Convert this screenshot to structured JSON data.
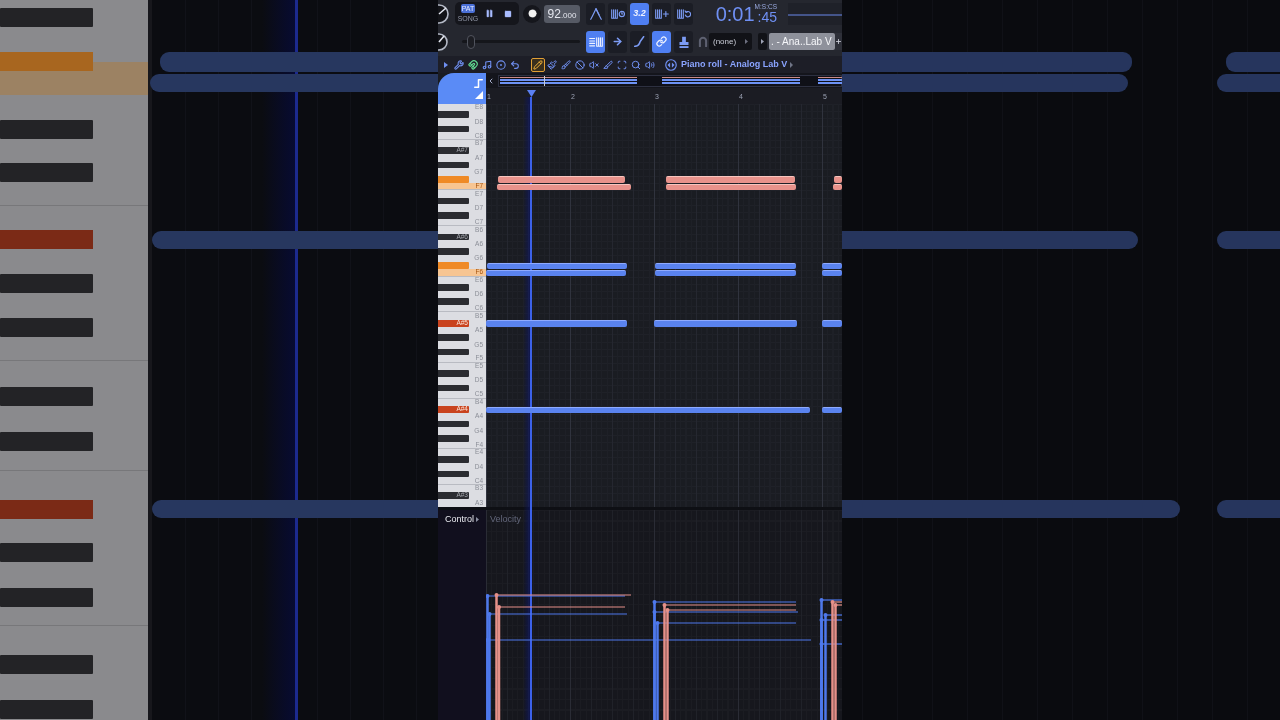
{
  "toolbar": {
    "mode_switch": [
      {
        "label": "PAT",
        "selected": true
      },
      {
        "label": "SONG",
        "selected": false
      }
    ],
    "playing": true,
    "tempo": {
      "whole": "92",
      "decimals": ".000"
    },
    "record_options": [
      {
        "selected": false
      },
      {
        "selected": false
      },
      {
        "label": "3.2",
        "selected": true
      },
      {
        "selected": false
      },
      {
        "selected": false
      }
    ],
    "time": {
      "main": "0:01",
      "centis": ":45",
      "format": "M:S:CS"
    }
  },
  "toolbar_row2": {
    "slider": {
      "level": 0.08
    },
    "buttons": [
      {
        "selected": true
      },
      {
        "selected": false
      },
      {
        "selected": false
      },
      {
        "selected": true
      },
      {
        "selected": false
      }
    ],
    "target": "(none)",
    "channel": ". - Ana..Lab V"
  },
  "tool_strip": {
    "snap": {
      "on": true
    },
    "tools": [
      {
        "selected": true
      },
      {
        "selected": false
      },
      {
        "selected": false
      },
      {
        "selected": false
      },
      {
        "selected": false
      },
      {
        "selected": false
      },
      {
        "selected": false
      },
      {
        "selected": false
      },
      {
        "selected": false
      }
    ],
    "title": "Piano roll - Analog Lab V"
  },
  "ruler": [
    "1",
    "2",
    "3",
    "4",
    "5"
  ],
  "keys": [
    {
      "label": "E8",
      "kind": "white",
      "pressed": false
    },
    {
      "kind": "black",
      "pressed": false
    },
    {
      "label": "D8",
      "kind": "white",
      "pressed": false
    },
    {
      "kind": "black",
      "pressed": false
    },
    {
      "label": "C8",
      "kind": "white",
      "pressed": false
    },
    {
      "label": "B7",
      "kind": "white",
      "pressed": false
    },
    {
      "label": "A#7",
      "kind": "black",
      "pressed": false
    },
    {
      "label": "A7",
      "kind": "white",
      "pressed": false
    },
    {
      "kind": "black",
      "pressed": false
    },
    {
      "label": "G7",
      "kind": "white",
      "pressed": false
    },
    {
      "kind": "black",
      "pressed": true,
      "color": "#ef8a26"
    },
    {
      "label": "F7",
      "kind": "white",
      "pressed": true,
      "color": "#f7c592"
    },
    {
      "label": "E7",
      "kind": "white",
      "pressed": false
    },
    {
      "kind": "black",
      "pressed": false
    },
    {
      "label": "D7",
      "kind": "white",
      "pressed": false
    },
    {
      "kind": "black",
      "pressed": false
    },
    {
      "label": "C7",
      "kind": "white",
      "pressed": false
    },
    {
      "label": "B6",
      "kind": "white",
      "pressed": false
    },
    {
      "label": "A#6",
      "kind": "black",
      "pressed": false
    },
    {
      "label": "A6",
      "kind": "white",
      "pressed": false
    },
    {
      "kind": "black",
      "pressed": false
    },
    {
      "label": "G6",
      "kind": "white",
      "pressed": false
    },
    {
      "kind": "black",
      "pressed": true,
      "color": "#ef8a26"
    },
    {
      "label": "F6",
      "kind": "white",
      "pressed": true,
      "color": "#f7c592"
    },
    {
      "label": "E6",
      "kind": "white",
      "pressed": false
    },
    {
      "kind": "black",
      "pressed": false
    },
    {
      "label": "D6",
      "kind": "white",
      "pressed": false
    },
    {
      "kind": "black",
      "pressed": false
    },
    {
      "label": "C6",
      "kind": "white",
      "pressed": false
    },
    {
      "label": "B5",
      "kind": "white",
      "pressed": false
    },
    {
      "label": "A#5",
      "kind": "black",
      "pressed": true,
      "color": "#c9431e"
    },
    {
      "label": "A5",
      "kind": "white",
      "pressed": false
    },
    {
      "kind": "black",
      "pressed": false
    },
    {
      "label": "G5",
      "kind": "white",
      "pressed": false
    },
    {
      "kind": "black",
      "pressed": false
    },
    {
      "label": "F5",
      "kind": "white",
      "pressed": false
    },
    {
      "label": "E5",
      "kind": "white",
      "pressed": false
    },
    {
      "kind": "black",
      "pressed": false
    },
    {
      "label": "D5",
      "kind": "white",
      "pressed": false
    },
    {
      "kind": "black",
      "pressed": false
    },
    {
      "label": "C5",
      "kind": "white",
      "pressed": false
    },
    {
      "label": "B4",
      "kind": "white",
      "pressed": false
    },
    {
      "label": "A#4",
      "kind": "black",
      "pressed": true,
      "color": "#c9431e"
    },
    {
      "label": "A4",
      "kind": "white",
      "pressed": false
    },
    {
      "kind": "black",
      "pressed": false
    },
    {
      "label": "G4",
      "kind": "white",
      "pressed": false
    },
    {
      "kind": "black",
      "pressed": false
    },
    {
      "label": "F4",
      "kind": "white",
      "pressed": false
    },
    {
      "label": "E4",
      "kind": "white",
      "pressed": false
    },
    {
      "kind": "black",
      "pressed": false
    },
    {
      "label": "D4",
      "kind": "white",
      "pressed": false
    },
    {
      "kind": "black",
      "pressed": false
    },
    {
      "label": "C4",
      "kind": "white",
      "pressed": false
    },
    {
      "label": "B3",
      "kind": "white",
      "pressed": false
    },
    {
      "label": "A#3",
      "kind": "black",
      "pressed": false
    },
    {
      "label": "A3",
      "kind": "white",
      "pressed": false
    }
  ],
  "event_editor": {
    "control": "Control",
    "parameter": "Velocity"
  }
}
